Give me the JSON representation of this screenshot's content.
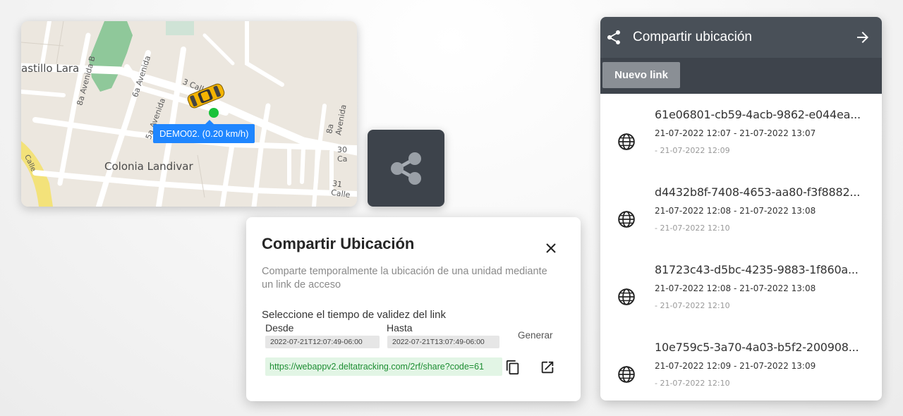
{
  "map": {
    "labels": {
      "castillo": "astillo Lara",
      "av_b": "8a Avenida B",
      "av6": "6a Avenida",
      "calle3": "3 Calle",
      "av5": "5a Avenida",
      "av8": "8a Avenida",
      "calle30": "30 Ca",
      "calle31": "31 Calle",
      "colonia": "Colonia Landivar",
      "calle_left": "Calle"
    },
    "tooltip": "DEMO02. (0.20 km/h)"
  },
  "dialog": {
    "title": "Compartir Ubicación",
    "description": "Comparte temporalmente la ubicación de una unidad mediante un link de acceso",
    "prompt": "Seleccione el tiempo de validez del link",
    "desde_label": "Desde",
    "hasta_label": "Hasta",
    "generar_label": "Generar",
    "desde_value": "2022-07-21T12:07:49-06:00",
    "hasta_value": "2022-07-21T13:07:49-06:00",
    "link_value": "https://webappv2.deltatracking.com/2rf/share?code=61"
  },
  "panel": {
    "title": "Compartir ubicación",
    "new_link_label": "Nuevo link",
    "items": [
      {
        "id": "61e06801-cb59-4acb-9862-e044ea...",
        "range": "21-07-2022 12:07 - 21-07-2022 13:07",
        "created": "- 21-07-2022 12:09"
      },
      {
        "id": "d4432b8f-7408-4653-aa80-f3f8882...",
        "range": "21-07-2022 12:08 - 21-07-2022 13:08",
        "created": "- 21-07-2022 12:10"
      },
      {
        "id": "81723c43-d5bc-4235-9883-1f860a...",
        "range": "21-07-2022 12:08 - 21-07-2022 13:08",
        "created": "- 21-07-2022 12:10"
      },
      {
        "id": "10e759c5-3a70-4a03-b5f2-200908...",
        "range": "21-07-2022 12:09 - 21-07-2022 13:09",
        "created": "- 21-07-2022 12:10"
      }
    ]
  },
  "colors": {
    "header": "#495058",
    "toolbar": "#3e444c",
    "tooltip": "#1f86ff",
    "link_text": "#1e8e33",
    "link_bg": "#e2f5e5"
  },
  "icons": [
    "share-icon",
    "arrow-right-icon",
    "close-icon",
    "copy-icon",
    "open-in-new-icon",
    "globe-icon",
    "taxi-icon",
    "location-dot-icon"
  ]
}
